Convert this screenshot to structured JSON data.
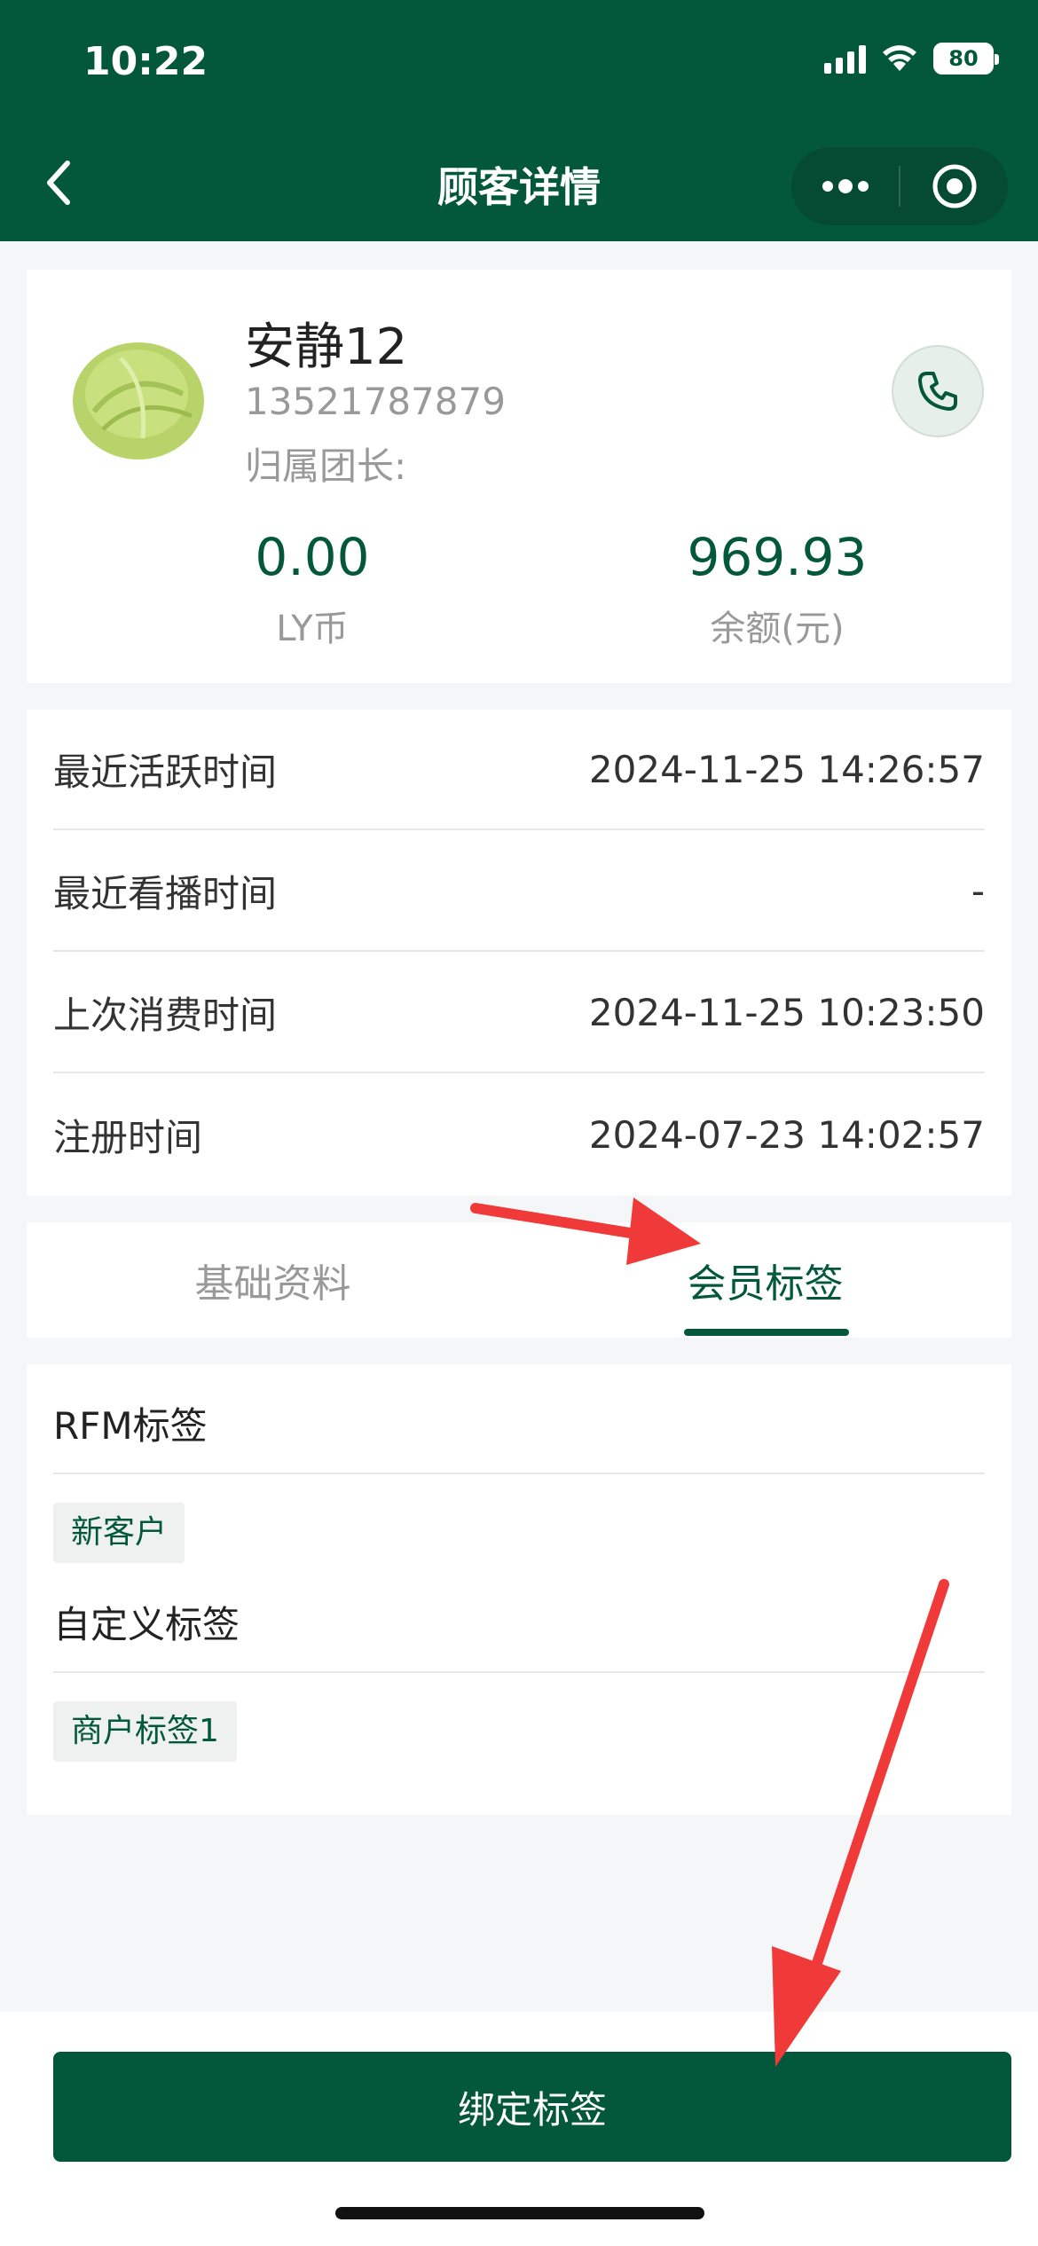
{
  "status_bar": {
    "time": "10:22",
    "battery": "80"
  },
  "nav": {
    "title": "顾客详情"
  },
  "profile": {
    "name": "安静12",
    "phone": "13521787879",
    "leader_label": "归属团长:",
    "stats": [
      {
        "value": "0.00",
        "label": "LY币"
      },
      {
        "value": "969.93",
        "label": "余额(元)"
      }
    ]
  },
  "times": [
    {
      "label": "最近活跃时间",
      "value": "2024-11-25 14:26:57"
    },
    {
      "label": "最近看播时间",
      "value": "-"
    },
    {
      "label": "上次消费时间",
      "value": "2024-11-25 10:23:50"
    },
    {
      "label": "注册时间",
      "value": "2024-07-23 14:02:57"
    }
  ],
  "tabs": [
    {
      "label": "基础资料",
      "active": false
    },
    {
      "label": "会员标签",
      "active": true
    }
  ],
  "tags": {
    "rfm_title": "RFM标签",
    "rfm_tag": "新客户",
    "custom_title": "自定义标签",
    "custom_tag": "商户标签1"
  },
  "bind_button": "绑定标签",
  "colors": {
    "brand": "#03583b",
    "annotation": "#f03a3a"
  }
}
